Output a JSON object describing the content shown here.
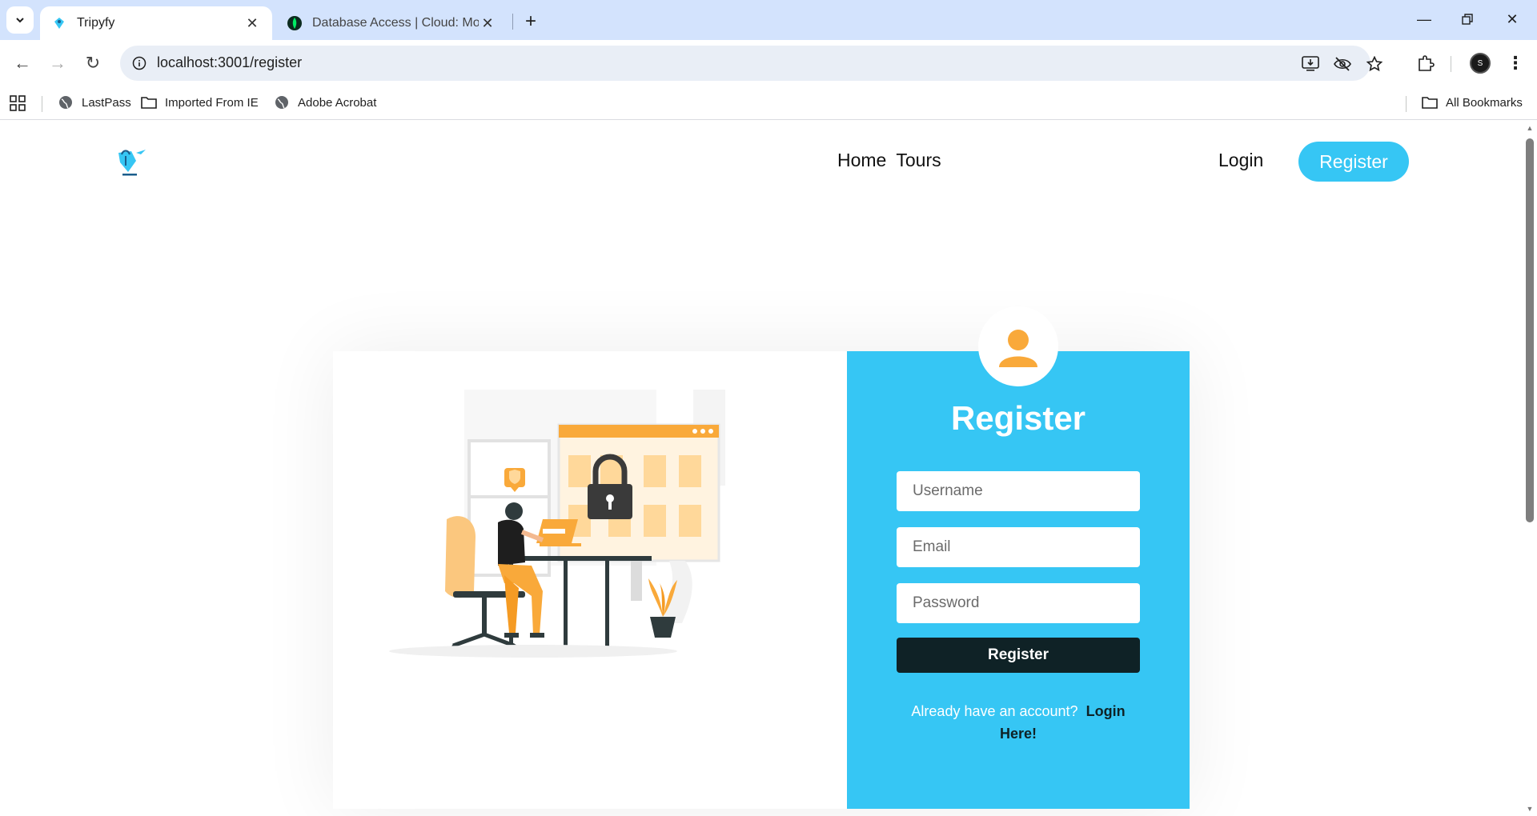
{
  "browser": {
    "tabs": [
      {
        "title": "Tripyfy",
        "active": true
      },
      {
        "title": "Database Access | Cloud: MongoDB Cloud",
        "active": false
      }
    ],
    "url": "localhost:3001/register",
    "bookmarks": [
      {
        "label": "LastPass",
        "icon": "globe-icon"
      },
      {
        "label": "Imported From IE",
        "icon": "folder-icon"
      },
      {
        "label": "Adobe Acrobat",
        "icon": "globe-icon"
      }
    ],
    "all_bookmarks": "All Bookmarks",
    "profile_initial": "S"
  },
  "site": {
    "nav": {
      "home": "Home",
      "tours": "Tours"
    },
    "login": "Login",
    "register": "Register"
  },
  "form": {
    "title": "Register",
    "username_placeholder": "Username",
    "email_placeholder": "Email",
    "password_placeholder": "Password",
    "submit": "Register",
    "prompt": "Already have an account?",
    "login_link": "Login Here!"
  },
  "colors": {
    "accent": "#36c6f4",
    "dark": "#0f2226",
    "illustration_orange": "#f9a93a"
  }
}
